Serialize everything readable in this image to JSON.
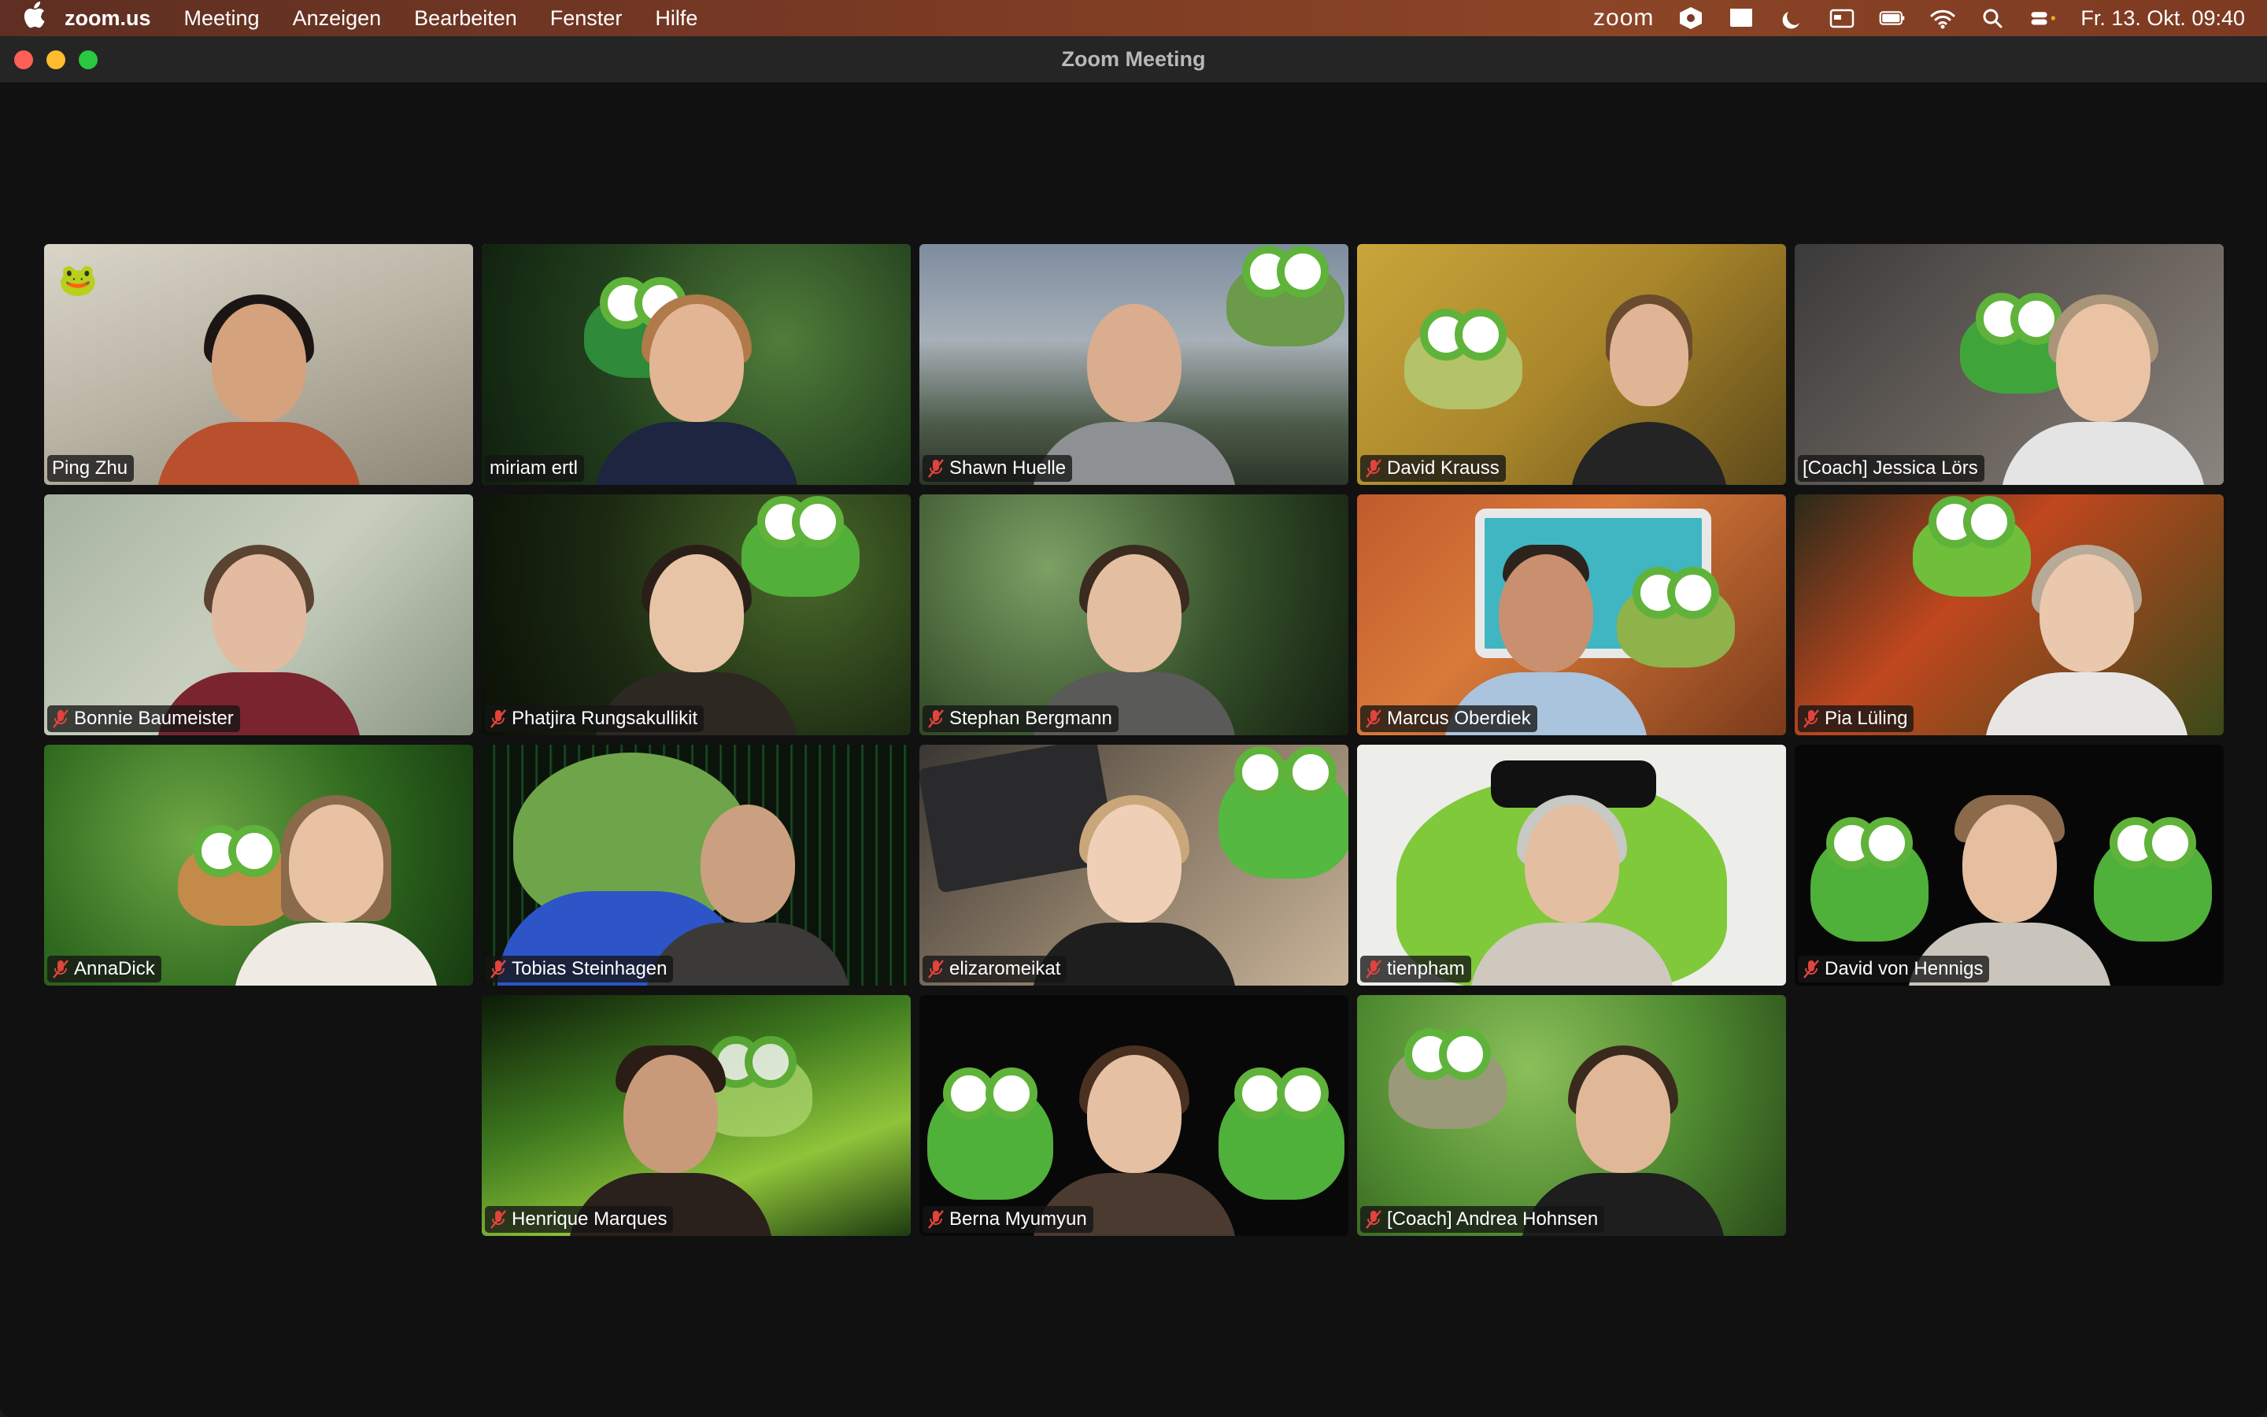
{
  "menubar": {
    "apple_icon": "apple-icon",
    "app_name": "zoom.us",
    "items": [
      "Meeting",
      "Anzeigen",
      "Bearbeiten",
      "Fenster",
      "Hilfe"
    ],
    "zoom_status": "zoom",
    "datetime": "Fr. 13. Okt.  09:40"
  },
  "window": {
    "title": "Zoom Meeting"
  },
  "participants": [
    {
      "name": "Ping Zhu",
      "muted": false,
      "active": false
    },
    {
      "name": "miriam ertl",
      "muted": false,
      "active": true
    },
    {
      "name": "Shawn Huelle",
      "muted": true,
      "active": false
    },
    {
      "name": "David Krauss",
      "muted": true,
      "active": false
    },
    {
      "name": "[Coach] Jessica Lörs",
      "muted": false,
      "active": false
    },
    {
      "name": "Bonnie Baumeister",
      "muted": true,
      "active": false
    },
    {
      "name": "Phatjira Rungsakullikit",
      "muted": true,
      "active": false
    },
    {
      "name": "Stephan Bergmann",
      "muted": true,
      "active": false
    },
    {
      "name": "Marcus Oberdiek",
      "muted": true,
      "active": false
    },
    {
      "name": "Pia Lüling",
      "muted": true,
      "active": false
    },
    {
      "name": "AnnaDick",
      "muted": true,
      "active": false
    },
    {
      "name": "Tobias Steinhagen",
      "muted": true,
      "active": false
    },
    {
      "name": "elizaromeikat",
      "muted": true,
      "active": false
    },
    {
      "name": "tienpham",
      "muted": true,
      "active": false
    },
    {
      "name": "David von Hennigs",
      "muted": true,
      "active": false
    },
    {
      "name": "Henrique Marques",
      "muted": true,
      "active": false
    },
    {
      "name": "Berna Myumyun",
      "muted": true,
      "active": false
    },
    {
      "name": "[Coach] Andrea Hohnsen",
      "muted": true,
      "active": false
    }
  ],
  "colors": {
    "active_speaker": "#34d058",
    "mute_red": "#e0443c",
    "window_bg": "#111111"
  }
}
